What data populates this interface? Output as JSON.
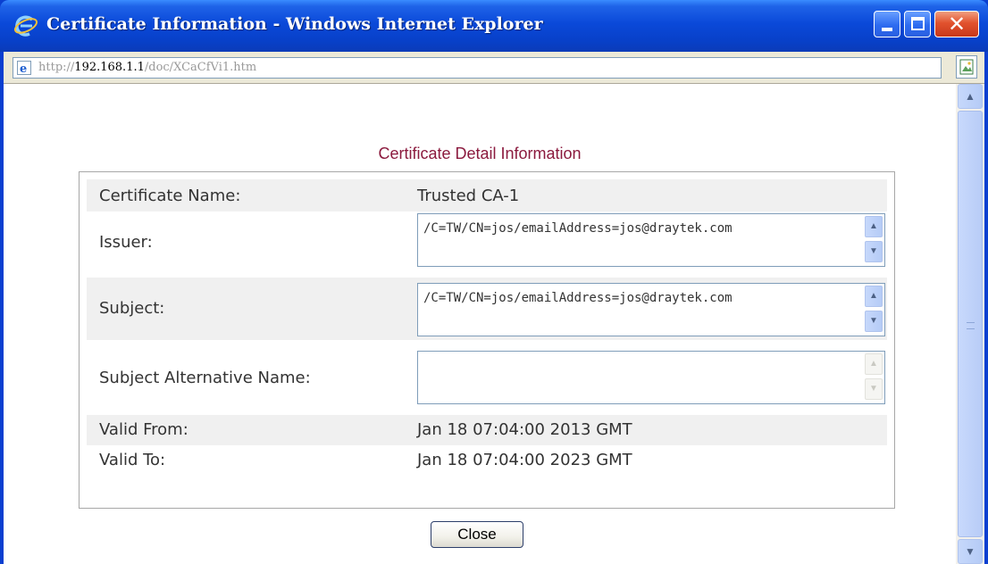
{
  "window": {
    "title": "Certificate Information - Windows Internet Explorer"
  },
  "address_bar": {
    "url_prefix": "http://",
    "url_host": "192.168.1.1",
    "url_path": "/doc/XCaCfVi1.htm"
  },
  "certificate": {
    "heading": "Certificate Detail Information",
    "fields": {
      "name_label": "Certificate Name:",
      "name_value": "Trusted CA-1",
      "issuer_label": "Issuer:",
      "issuer_value": "/C=TW/CN=jos/emailAddress=jos@draytek.com",
      "subject_label": "Subject:",
      "subject_value": "/C=TW/CN=jos/emailAddress=jos@draytek.com",
      "alt_name_label": "Subject Alternative Name:",
      "alt_name_value": "",
      "valid_from_label": "Valid From:",
      "valid_from_value": "Jan 18 07:04:00 2013 GMT",
      "valid_to_label": "Valid To:",
      "valid_to_value": "Jan 18 07:04:00 2023 GMT"
    }
  },
  "buttons": {
    "close_label": "Close"
  },
  "icons": {
    "title": "internet-explorer-icon",
    "address": "internet-explorer-page-icon",
    "page": "page-image-icon"
  },
  "colors": {
    "titlebar": "#0a49d9",
    "heading": "#8b1a3e",
    "close_window": "#e2522e"
  }
}
